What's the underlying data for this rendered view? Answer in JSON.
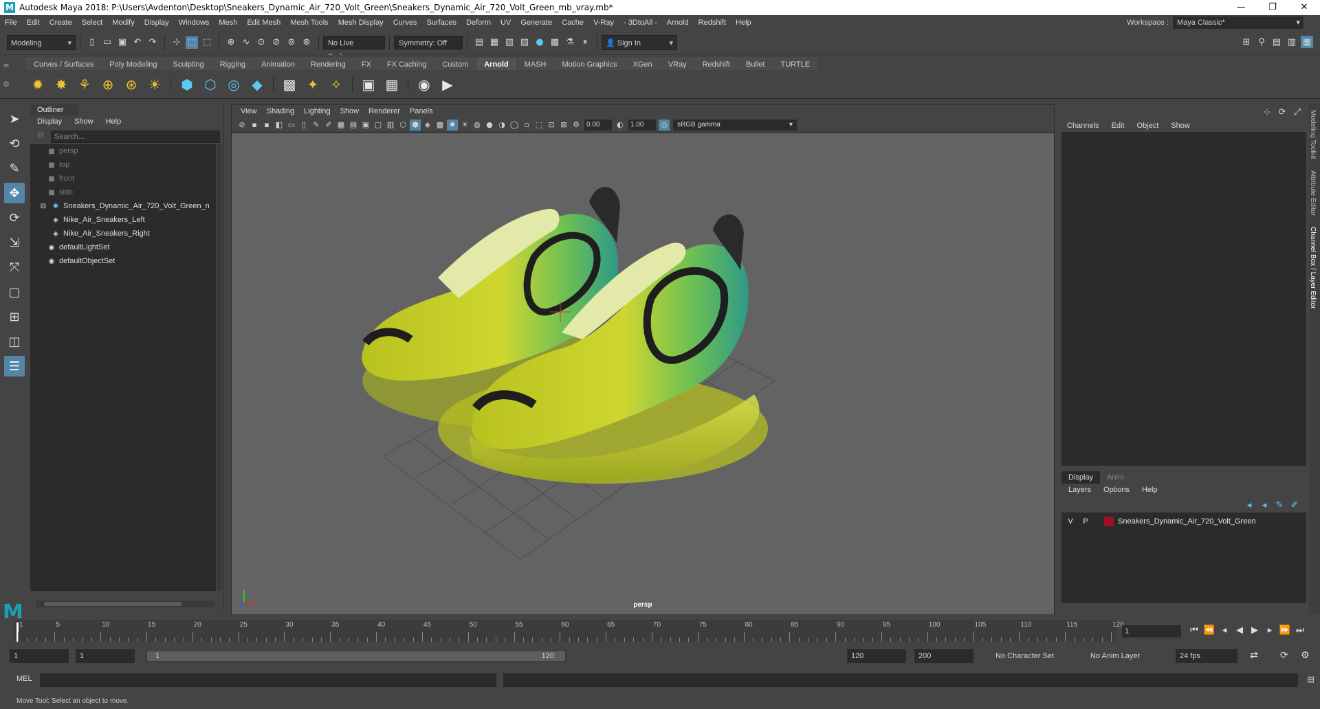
{
  "window": {
    "title": "Autodesk Maya 2018: P:\\Users\\Avdenton\\Desktop\\Sneakers_Dynamic_Air_720_Volt_Green\\Sneakers_Dynamic_Air_720_Volt_Green_mb_vray.mb*",
    "logo_letter": "M",
    "minimize": "—",
    "maximize": "❐",
    "close": "✕"
  },
  "menubar": {
    "items": [
      "File",
      "Edit",
      "Create",
      "Select",
      "Modify",
      "Display",
      "Windows",
      "Mesh",
      "Edit Mesh",
      "Mesh Tools",
      "Mesh Display",
      "Curves",
      "Surfaces",
      "Deform",
      "UV",
      "Generate",
      "Cache",
      "V-Ray",
      "- 3DtoAll -",
      "Arnold",
      "Redshift",
      "Help"
    ],
    "workspace_label": "Workspace :",
    "workspace_value": "Maya Classic*"
  },
  "statusline": {
    "mode": "Modeling",
    "live_surface": "No Live Surface",
    "symmetry": "Symmetry: Off",
    "sign_in": "Sign In"
  },
  "shelf": {
    "tabs": [
      "Curves / Surfaces",
      "Poly Modeling",
      "Sculpting",
      "Rigging",
      "Animation",
      "Rendering",
      "FX",
      "FX Caching",
      "Custom",
      "Arnold",
      "MASH",
      "Motion Graphics",
      "XGen",
      "VRay",
      "Redshift",
      "Bullet",
      "TURTLE"
    ],
    "active_tab": "Arnold"
  },
  "outliner": {
    "title": "Outliner",
    "menu": [
      "Display",
      "Show",
      "Help"
    ],
    "search_placeholder": "Search...",
    "items": [
      {
        "label": "persp",
        "dim": true,
        "indent": 0,
        "icon": "camera-icon"
      },
      {
        "label": "top",
        "dim": true,
        "indent": 0,
        "icon": "camera-icon"
      },
      {
        "label": "front",
        "dim": true,
        "indent": 0,
        "icon": "camera-icon"
      },
      {
        "label": "side",
        "dim": true,
        "indent": 0,
        "icon": "camera-icon"
      },
      {
        "label": "Sneakers_Dynamic_Air_720_Volt_Green_n",
        "dim": false,
        "indent": 0,
        "icon": "group-icon"
      },
      {
        "label": "Nike_Air_Sneakers_Left",
        "dim": false,
        "indent": 1,
        "icon": "mesh-icon"
      },
      {
        "label": "Nike_Air_Sneakers_Right",
        "dim": false,
        "indent": 1,
        "icon": "mesh-icon"
      },
      {
        "label": "defaultLightSet",
        "dim": false,
        "indent": 0,
        "icon": "set-icon"
      },
      {
        "label": "defaultObjectSet",
        "dim": false,
        "indent": 0,
        "icon": "set-icon"
      }
    ]
  },
  "viewport": {
    "menu": [
      "View",
      "Shading",
      "Lighting",
      "Show",
      "Renderer",
      "Panels"
    ],
    "exposure": "0.00",
    "gamma": "1.00",
    "color_space": "sRGB gamma",
    "camera_label": "persp"
  },
  "channel_box": {
    "menu": [
      "Channels",
      "Edit",
      "Object",
      "Show"
    ]
  },
  "layer_editor": {
    "tabs": [
      "Display",
      "Anim"
    ],
    "active_tab": "Display",
    "menu": [
      "Layers",
      "Options",
      "Help"
    ],
    "layer": {
      "v": "V",
      "p": "P",
      "name": "Sneakers_Dynamic_Air_720_Volt_Green",
      "color": "#a0102a"
    }
  },
  "side_tabs": [
    "Modeling Toolkit",
    "Attribute Editor",
    "Channel Box / Layer Editor"
  ],
  "timeline": {
    "ticks": [
      1,
      5,
      10,
      15,
      20,
      25,
      30,
      35,
      40,
      45,
      50,
      55,
      60,
      65,
      70,
      75,
      80,
      85,
      90,
      95,
      100,
      105,
      110,
      115,
      120
    ],
    "start": 1,
    "end": 120,
    "current_frame": "1"
  },
  "range": {
    "start_time": "1",
    "playback_start": "1",
    "slider_start": "1",
    "slider_end": "120",
    "playback_end": "120",
    "end_time": "200",
    "character_set": "No Character Set",
    "anim_layer": "No Anim Layer",
    "fps": "24 fps"
  },
  "command": {
    "label": "MEL"
  },
  "help_line": "Move Tool: Select an object to move.",
  "colors": {
    "accent": "#5285a6",
    "maya_teal": "#1ba0b5",
    "shoe_volt": "#c8d42a",
    "shoe_teal": "#35b08a"
  }
}
